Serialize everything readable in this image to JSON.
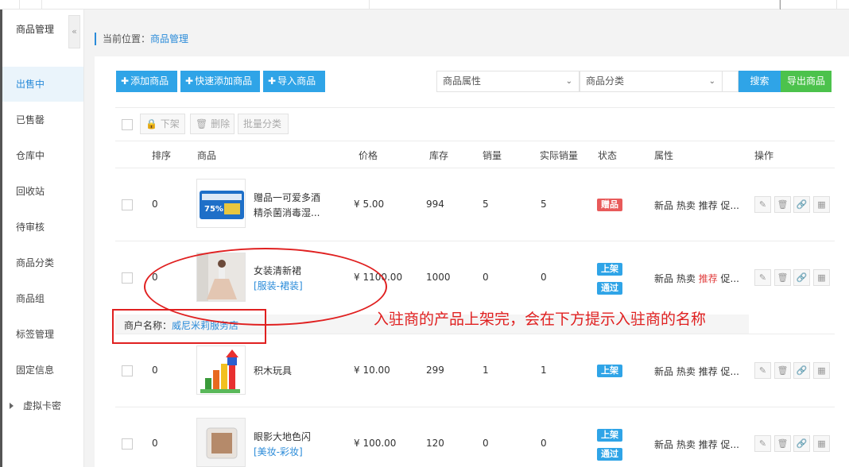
{
  "sidebar": {
    "title": "商品管理",
    "collapse_icon": "«",
    "items": [
      {
        "label": "出售中",
        "active": true
      },
      {
        "label": "已售罄"
      },
      {
        "label": "仓库中"
      },
      {
        "label": "回收站"
      },
      {
        "label": "待审核"
      },
      {
        "label": "商品分类"
      },
      {
        "label": "商品组"
      },
      {
        "label": "标签管理"
      },
      {
        "label": "固定信息"
      },
      {
        "label": "虚拟卡密"
      }
    ]
  },
  "breadcrumb": {
    "prefix": "当前位置：",
    "current": "商品管理"
  },
  "toolbar": {
    "add_product": "添加商品",
    "quick_add": "快速添加商品",
    "import": "导入商品",
    "plus": "✚",
    "attr_select": "商品属性",
    "category_select": "商品分类",
    "search": "搜索",
    "export": "导出商品"
  },
  "bulk": {
    "offshelf": "下架",
    "delete": "删除",
    "batch_category": "批量分类"
  },
  "columns": {
    "sort": "排序",
    "product": "商品",
    "price": "价格",
    "stock": "库存",
    "sales": "销量",
    "actual_sales": "实际销量",
    "status": "状态",
    "attributes": "属性",
    "actions": "操作"
  },
  "rows": [
    {
      "sort": "0",
      "name": "赠品一可爱多酒精杀菌消毒湿...",
      "category": "",
      "price": "¥ 5.00",
      "stock": "994",
      "sales": "5",
      "actual_sales": "5",
      "tags": [
        "赠品"
      ],
      "attrs": [
        "新品",
        "热卖",
        "推荐",
        "促..."
      ]
    },
    {
      "sort": "0",
      "name": "女装清新裙",
      "category": "[服装-裙装]",
      "price": "¥ 1100.00",
      "stock": "1000",
      "sales": "0",
      "actual_sales": "0",
      "tags": [
        "上架",
        "通过"
      ],
      "attrs": [
        "新品",
        "热卖",
        "推荐",
        "促..."
      ]
    },
    {
      "sort": "0",
      "name": "积木玩具",
      "category": "",
      "price": "¥ 10.00",
      "stock": "299",
      "sales": "1",
      "actual_sales": "1",
      "tags": [
        "上架"
      ],
      "attrs": [
        "新品",
        "热卖",
        "推荐",
        "促..."
      ]
    },
    {
      "sort": "0",
      "name": "眼影大地色闪",
      "category": "[美妆-彩妆]",
      "price": "¥ 100.00",
      "stock": "120",
      "sales": "0",
      "actual_sales": "0",
      "tags": [
        "上架",
        "通过"
      ],
      "attrs": [
        "新品",
        "热卖",
        "推荐",
        "促..."
      ]
    }
  ],
  "merchant": {
    "label": "商户名称：",
    "name": "威尼米莉服务店"
  },
  "annotation": {
    "text": "入驻商的产品上架完，会在下方提示入驻商的名称"
  },
  "colors": {
    "accent": "#2fa4e7",
    "export_green": "#4cc24c",
    "tag_red": "#e85a5a",
    "annotation_red": "#e02020"
  }
}
